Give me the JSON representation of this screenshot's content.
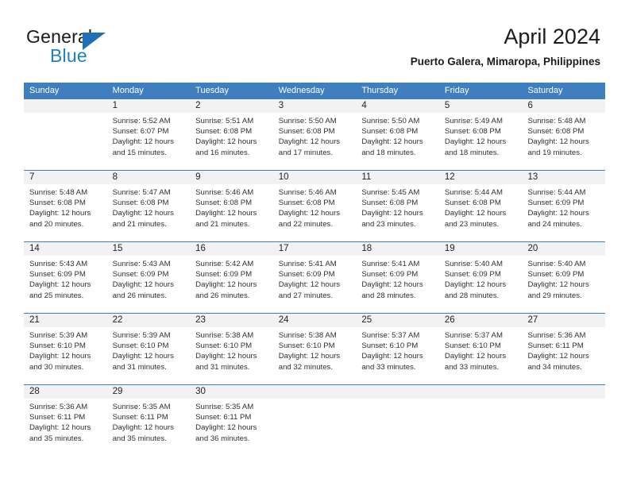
{
  "brand": {
    "name_part1": "General",
    "name_part2": "Blue",
    "logo_icon": "triangle-flag-icon",
    "accent_color": "#1f7fc4"
  },
  "header": {
    "title": "April 2024",
    "subtitle": "Puerto Galera, Mimaropa, Philippines"
  },
  "theme": {
    "header_row_bg": "#3f7fbf",
    "day_band_bg": "#f2f2f2",
    "grid_line": "#3f7fbf",
    "text": "#303030"
  },
  "weekdays": [
    "Sunday",
    "Monday",
    "Tuesday",
    "Wednesday",
    "Thursday",
    "Friday",
    "Saturday"
  ],
  "weeks": [
    [
      {
        "day": "",
        "sunrise": "",
        "sunset": "",
        "daylight1": "",
        "daylight2": "",
        "empty": true
      },
      {
        "day": "1",
        "sunrise": "Sunrise: 5:52 AM",
        "sunset": "Sunset: 6:07 PM",
        "daylight1": "Daylight: 12 hours",
        "daylight2": "and 15 minutes.",
        "empty": false
      },
      {
        "day": "2",
        "sunrise": "Sunrise: 5:51 AM",
        "sunset": "Sunset: 6:08 PM",
        "daylight1": "Daylight: 12 hours",
        "daylight2": "and 16 minutes.",
        "empty": false
      },
      {
        "day": "3",
        "sunrise": "Sunrise: 5:50 AM",
        "sunset": "Sunset: 6:08 PM",
        "daylight1": "Daylight: 12 hours",
        "daylight2": "and 17 minutes.",
        "empty": false
      },
      {
        "day": "4",
        "sunrise": "Sunrise: 5:50 AM",
        "sunset": "Sunset: 6:08 PM",
        "daylight1": "Daylight: 12 hours",
        "daylight2": "and 18 minutes.",
        "empty": false
      },
      {
        "day": "5",
        "sunrise": "Sunrise: 5:49 AM",
        "sunset": "Sunset: 6:08 PM",
        "daylight1": "Daylight: 12 hours",
        "daylight2": "and 18 minutes.",
        "empty": false
      },
      {
        "day": "6",
        "sunrise": "Sunrise: 5:48 AM",
        "sunset": "Sunset: 6:08 PM",
        "daylight1": "Daylight: 12 hours",
        "daylight2": "and 19 minutes.",
        "empty": false
      }
    ],
    [
      {
        "day": "7",
        "sunrise": "Sunrise: 5:48 AM",
        "sunset": "Sunset: 6:08 PM",
        "daylight1": "Daylight: 12 hours",
        "daylight2": "and 20 minutes.",
        "empty": false
      },
      {
        "day": "8",
        "sunrise": "Sunrise: 5:47 AM",
        "sunset": "Sunset: 6:08 PM",
        "daylight1": "Daylight: 12 hours",
        "daylight2": "and 21 minutes.",
        "empty": false
      },
      {
        "day": "9",
        "sunrise": "Sunrise: 5:46 AM",
        "sunset": "Sunset: 6:08 PM",
        "daylight1": "Daylight: 12 hours",
        "daylight2": "and 21 minutes.",
        "empty": false
      },
      {
        "day": "10",
        "sunrise": "Sunrise: 5:46 AM",
        "sunset": "Sunset: 6:08 PM",
        "daylight1": "Daylight: 12 hours",
        "daylight2": "and 22 minutes.",
        "empty": false
      },
      {
        "day": "11",
        "sunrise": "Sunrise: 5:45 AM",
        "sunset": "Sunset: 6:08 PM",
        "daylight1": "Daylight: 12 hours",
        "daylight2": "and 23 minutes.",
        "empty": false
      },
      {
        "day": "12",
        "sunrise": "Sunrise: 5:44 AM",
        "sunset": "Sunset: 6:08 PM",
        "daylight1": "Daylight: 12 hours",
        "daylight2": "and 23 minutes.",
        "empty": false
      },
      {
        "day": "13",
        "sunrise": "Sunrise: 5:44 AM",
        "sunset": "Sunset: 6:09 PM",
        "daylight1": "Daylight: 12 hours",
        "daylight2": "and 24 minutes.",
        "empty": false
      }
    ],
    [
      {
        "day": "14",
        "sunrise": "Sunrise: 5:43 AM",
        "sunset": "Sunset: 6:09 PM",
        "daylight1": "Daylight: 12 hours",
        "daylight2": "and 25 minutes.",
        "empty": false
      },
      {
        "day": "15",
        "sunrise": "Sunrise: 5:43 AM",
        "sunset": "Sunset: 6:09 PM",
        "daylight1": "Daylight: 12 hours",
        "daylight2": "and 26 minutes.",
        "empty": false
      },
      {
        "day": "16",
        "sunrise": "Sunrise: 5:42 AM",
        "sunset": "Sunset: 6:09 PM",
        "daylight1": "Daylight: 12 hours",
        "daylight2": "and 26 minutes.",
        "empty": false
      },
      {
        "day": "17",
        "sunrise": "Sunrise: 5:41 AM",
        "sunset": "Sunset: 6:09 PM",
        "daylight1": "Daylight: 12 hours",
        "daylight2": "and 27 minutes.",
        "empty": false
      },
      {
        "day": "18",
        "sunrise": "Sunrise: 5:41 AM",
        "sunset": "Sunset: 6:09 PM",
        "daylight1": "Daylight: 12 hours",
        "daylight2": "and 28 minutes.",
        "empty": false
      },
      {
        "day": "19",
        "sunrise": "Sunrise: 5:40 AM",
        "sunset": "Sunset: 6:09 PM",
        "daylight1": "Daylight: 12 hours",
        "daylight2": "and 28 minutes.",
        "empty": false
      },
      {
        "day": "20",
        "sunrise": "Sunrise: 5:40 AM",
        "sunset": "Sunset: 6:09 PM",
        "daylight1": "Daylight: 12 hours",
        "daylight2": "and 29 minutes.",
        "empty": false
      }
    ],
    [
      {
        "day": "21",
        "sunrise": "Sunrise: 5:39 AM",
        "sunset": "Sunset: 6:10 PM",
        "daylight1": "Daylight: 12 hours",
        "daylight2": "and 30 minutes.",
        "empty": false
      },
      {
        "day": "22",
        "sunrise": "Sunrise: 5:39 AM",
        "sunset": "Sunset: 6:10 PM",
        "daylight1": "Daylight: 12 hours",
        "daylight2": "and 31 minutes.",
        "empty": false
      },
      {
        "day": "23",
        "sunrise": "Sunrise: 5:38 AM",
        "sunset": "Sunset: 6:10 PM",
        "daylight1": "Daylight: 12 hours",
        "daylight2": "and 31 minutes.",
        "empty": false
      },
      {
        "day": "24",
        "sunrise": "Sunrise: 5:38 AM",
        "sunset": "Sunset: 6:10 PM",
        "daylight1": "Daylight: 12 hours",
        "daylight2": "and 32 minutes.",
        "empty": false
      },
      {
        "day": "25",
        "sunrise": "Sunrise: 5:37 AM",
        "sunset": "Sunset: 6:10 PM",
        "daylight1": "Daylight: 12 hours",
        "daylight2": "and 33 minutes.",
        "empty": false
      },
      {
        "day": "26",
        "sunrise": "Sunrise: 5:37 AM",
        "sunset": "Sunset: 6:10 PM",
        "daylight1": "Daylight: 12 hours",
        "daylight2": "and 33 minutes.",
        "empty": false
      },
      {
        "day": "27",
        "sunrise": "Sunrise: 5:36 AM",
        "sunset": "Sunset: 6:11 PM",
        "daylight1": "Daylight: 12 hours",
        "daylight2": "and 34 minutes.",
        "empty": false
      }
    ],
    [
      {
        "day": "28",
        "sunrise": "Sunrise: 5:36 AM",
        "sunset": "Sunset: 6:11 PM",
        "daylight1": "Daylight: 12 hours",
        "daylight2": "and 35 minutes.",
        "empty": false
      },
      {
        "day": "29",
        "sunrise": "Sunrise: 5:35 AM",
        "sunset": "Sunset: 6:11 PM",
        "daylight1": "Daylight: 12 hours",
        "daylight2": "and 35 minutes.",
        "empty": false
      },
      {
        "day": "30",
        "sunrise": "Sunrise: 5:35 AM",
        "sunset": "Sunset: 6:11 PM",
        "daylight1": "Daylight: 12 hours",
        "daylight2": "and 36 minutes.",
        "empty": false
      },
      {
        "day": "",
        "sunrise": "",
        "sunset": "",
        "daylight1": "",
        "daylight2": "",
        "empty": true
      },
      {
        "day": "",
        "sunrise": "",
        "sunset": "",
        "daylight1": "",
        "daylight2": "",
        "empty": true
      },
      {
        "day": "",
        "sunrise": "",
        "sunset": "",
        "daylight1": "",
        "daylight2": "",
        "empty": true
      },
      {
        "day": "",
        "sunrise": "",
        "sunset": "",
        "daylight1": "",
        "daylight2": "",
        "empty": true
      }
    ]
  ]
}
